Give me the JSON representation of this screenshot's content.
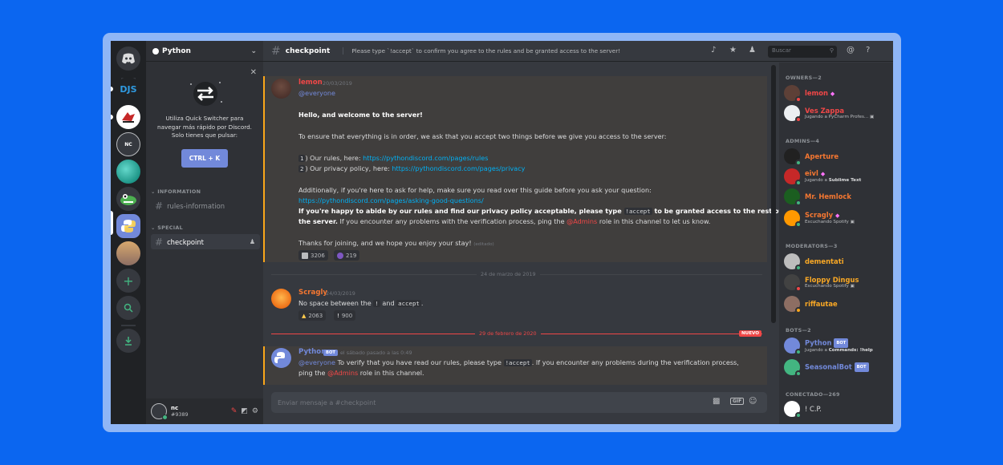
{
  "server": {
    "name": "Python"
  },
  "quick_switcher": {
    "text_lines": [
      "Utiliza Quick Switcher para",
      "navegar más rápido por Discord.",
      "Solo tienes que pulsar:"
    ],
    "shortcut": "CTRL + K"
  },
  "guilds": [
    {
      "label": "DJS"
    },
    {
      "label": "NC"
    }
  ],
  "categories": {
    "information": "INFORMATION",
    "special": "SPECIAL"
  },
  "channels": {
    "rules": "rules-information",
    "checkpoint": "checkpoint"
  },
  "user": {
    "name": "nc",
    "tag": "#9389"
  },
  "channel_header": {
    "name": "checkpoint",
    "topic": "Please type `!accept` to confirm you agree to the rules and be granted access to the server!"
  },
  "search": {
    "placeholder": "Buscar"
  },
  "messages": {
    "m1": {
      "author": "lemon",
      "timestamp": "20/03/2019",
      "mention": "@everyone",
      "greeting": "Hello, and welcome to the server!",
      "intro": "To ensure that everything is in order, we ask that you accept two things before we give you access to the server:",
      "item1_num": "1",
      "item1_text": ") Our rules, here: ",
      "item1_link": "https://pythondiscord.com/pages/rules",
      "item2_num": "2",
      "item2_text": ") Our privacy policy, here: ",
      "item2_link": "https://pythondiscord.com/pages/privacy",
      "help_text": "Additionally, if you're here to ask for help, make sure you read over this guide before you ask your question:",
      "help_link": "https://pythondiscord.com/pages/asking-good-questions/",
      "accept_a": "If you're happy to abide by our rules and find our privacy policy acceptable, please type ",
      "accept_code": "!accept",
      "accept_b": " to be granted access to the rest of",
      "accept_c": "the server.",
      "accept_d": " If you encounter any problems with the verification process, ping the ",
      "accept_role": "@Admins",
      "accept_e": " role in this channel to let us know.",
      "thanks": "Thanks for joining, and we hope you enjoy your stay!",
      "edited": "(editado)",
      "reactions": [
        {
          "count": "3206"
        },
        {
          "count": "219"
        }
      ]
    },
    "div1": "24 de marzo de 2019",
    "m2": {
      "author": "Scragly",
      "timestamp": "24/03/2019",
      "text_a": "No space between the ",
      "code_a": "!",
      "text_b": " and ",
      "code_b": "accept",
      "text_c": ".",
      "reactions": [
        {
          "count": "2063"
        },
        {
          "count": "900"
        }
      ]
    },
    "div2": "29 de febrero de 2020",
    "new_badge": "NUEVO",
    "m3": {
      "author": "Python",
      "bot": "BOT",
      "timestamp": "el sábado pasado a las 0:49",
      "mention": "@everyone",
      "text_a": " To verify that you have read our rules, please type ",
      "code": "!accept",
      "text_b": ". If you encounter any problems during the verification process,",
      "text_c": "ping the ",
      "role": "@Admins",
      "text_d": " role in this channel."
    }
  },
  "composer": {
    "placeholder": "Enviar mensaje a #checkpoint",
    "gif": "GIF"
  },
  "members": {
    "owners": {
      "header": "OWNERS—2",
      "list": [
        {
          "name": "lemon",
          "status": ""
        },
        {
          "name": "Ves Zappa",
          "status": "Jugando a PyCharm Profes..."
        }
      ]
    },
    "admins": {
      "header": "ADMINS—4",
      "list": [
        {
          "name": "Aperture",
          "status": ""
        },
        {
          "name": "eivl",
          "status_pre": "Jugando a ",
          "status_b": "Sublime Text"
        },
        {
          "name": "Mr. Hemlock",
          "status": ""
        },
        {
          "name": "Scragly",
          "status": "Escuchando Spotify"
        }
      ]
    },
    "moderators": {
      "header": "MODERATORS—3",
      "list": [
        {
          "name": "dementati",
          "status": ""
        },
        {
          "name": "Floppy Dingus",
          "status": "Escuchando Spotify"
        },
        {
          "name": "riffautae",
          "status": ""
        }
      ]
    },
    "bots": {
      "header": "BOTS—2",
      "list": [
        {
          "name": "Python",
          "badge": "BOT",
          "status_pre": "Jugando a ",
          "status_b": "Commands: !help"
        },
        {
          "name": "SeasonalBot",
          "badge": "BOT"
        }
      ]
    },
    "online": {
      "header": "CONECTADO—269",
      "list": [
        {
          "name": "! C.P."
        }
      ]
    }
  },
  "colors": {
    "accent": "#7289da",
    "owner": "#f04747",
    "admin": "#f57731",
    "moderator": "#f9a825",
    "bot": "#7289da",
    "online": "#43b581",
    "dnd": "#f04747"
  }
}
